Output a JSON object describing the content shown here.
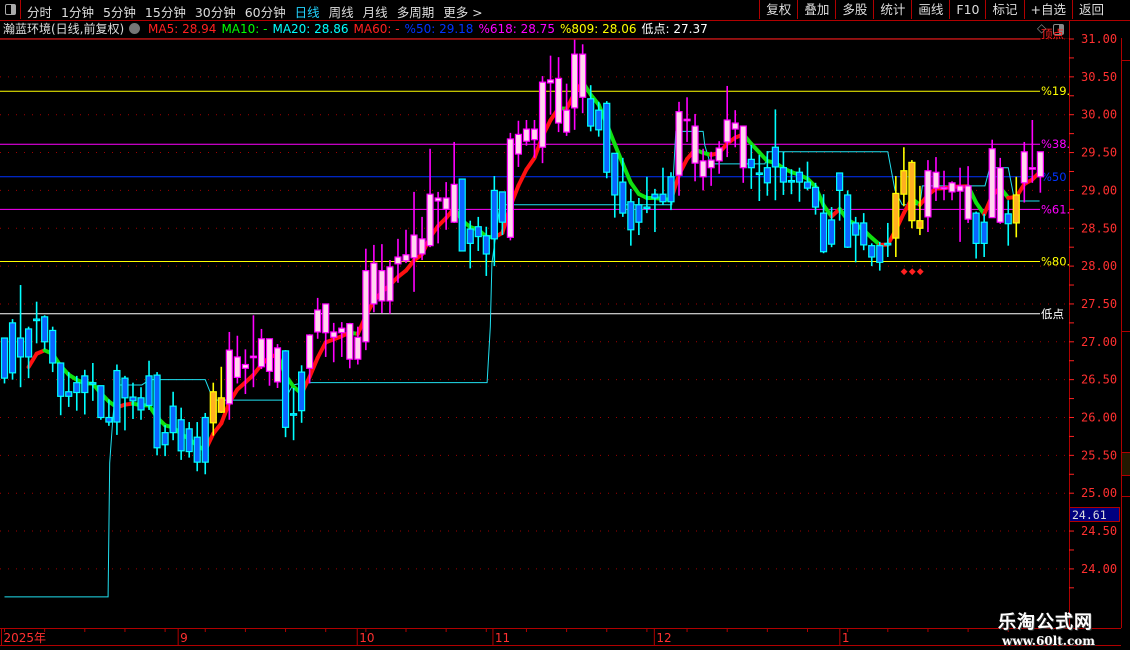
{
  "toolbar": {
    "periods": [
      "分时",
      "1分钟",
      "5分钟",
      "15分钟",
      "30分钟",
      "60分钟",
      "日线",
      "周线",
      "月线",
      "多周期",
      "更多 >"
    ],
    "active_period": "日线",
    "buttons": [
      "复权",
      "叠加",
      "多股",
      "统计",
      "画线",
      "F10",
      "标记",
      "+自选",
      "返回"
    ]
  },
  "info": {
    "title": "瀚蓝环境(日线,前复权)",
    "indicators": [
      {
        "text": "MA5: 28.94",
        "color": "#ff2020"
      },
      {
        "text": "MA10: -",
        "color": "#00ff00"
      },
      {
        "text": "MA20: 28.86",
        "color": "#00ffff"
      },
      {
        "text": "MA60: -",
        "color": "#ff2020"
      },
      {
        "text": "%50: 29.18",
        "color": "#0033ff"
      },
      {
        "text": "%618: 28.75",
        "color": "#ff00ff"
      },
      {
        "text": "%809: 28.06",
        "color": "#ffff00"
      },
      {
        "text": "低点: 27.37",
        "color": "#ffffff"
      }
    ]
  },
  "price_tag": "24.61",
  "watermark": {
    "title": "乐淘公式网",
    "url": "www.60lt.com"
  },
  "chart_data": {
    "type": "candlestick",
    "ylim": [
      23.6,
      31.0
    ],
    "y_ticks": [
      "24.00",
      "24.50",
      "25.00",
      "25.50",
      "26.00",
      "26.50",
      "27.00",
      "27.50",
      "28.00",
      "28.50",
      "29.00",
      "29.50",
      "30.00",
      "30.50",
      "31.00"
    ],
    "x_labels": [
      {
        "index": 0,
        "label": "2025年"
      },
      {
        "index": 22,
        "label": "9"
      },
      {
        "index": 44.3,
        "label": "10"
      },
      {
        "index": 61.2,
        "label": "11"
      },
      {
        "index": 81.3,
        "label": "12"
      },
      {
        "index": 104.4,
        "label": "1"
      }
    ],
    "candle_fields": [
      "open",
      "close",
      "high",
      "low",
      "style"
    ],
    "candle_styles": {
      "b": {
        "body": "#0a64ff",
        "edge": "#00ffff",
        "wick": "#00ffff"
      },
      "p": {
        "body": "#ffd6ee",
        "edge": "#ff00ff",
        "wick": "#ff00ff"
      },
      "y": {
        "body": "#ffb020",
        "edge": "#ffff00",
        "wick": "#ffff00"
      }
    },
    "candles": [
      [
        27.05,
        26.52,
        27.05,
        26.45,
        "b"
      ],
      [
        27.25,
        26.59,
        27.3,
        26.5,
        "b"
      ],
      [
        27.05,
        26.8,
        27.75,
        26.4,
        "b"
      ],
      [
        27.17,
        26.8,
        27.2,
        26.52,
        "b"
      ],
      [
        27.3,
        27.28,
        27.53,
        26.98,
        "b"
      ],
      [
        27.33,
        27.0,
        27.35,
        26.9,
        "b"
      ],
      [
        27.15,
        26.72,
        27.2,
        26.6,
        "b"
      ],
      [
        26.72,
        26.28,
        26.72,
        26.03,
        "b"
      ],
      [
        26.34,
        26.28,
        26.6,
        26.14,
        "b"
      ],
      [
        26.46,
        26.33,
        26.55,
        26.09,
        "b"
      ],
      [
        26.55,
        26.33,
        26.63,
        26.04,
        "b"
      ],
      [
        26.46,
        26.44,
        26.72,
        26.22,
        "b"
      ],
      [
        26.42,
        26.0,
        26.42,
        25.97,
        "b"
      ],
      [
        26.0,
        25.94,
        26.24,
        25.89,
        "b"
      ],
      [
        26.62,
        25.94,
        26.7,
        25.77,
        "b"
      ],
      [
        26.52,
        26.26,
        26.55,
        25.83,
        "b"
      ],
      [
        26.27,
        26.22,
        26.46,
        25.98,
        "b"
      ],
      [
        26.26,
        26.1,
        26.4,
        25.97,
        "b"
      ],
      [
        26.55,
        26.16,
        26.75,
        26.1,
        "b"
      ],
      [
        26.56,
        25.6,
        26.6,
        25.5,
        "b"
      ],
      [
        25.8,
        25.64,
        25.9,
        25.49,
        "b"
      ],
      [
        26.15,
        25.8,
        26.34,
        25.7,
        "b"
      ],
      [
        25.97,
        25.56,
        26.13,
        25.44,
        "b"
      ],
      [
        25.85,
        25.55,
        25.94,
        25.47,
        "b"
      ],
      [
        25.74,
        25.41,
        25.94,
        25.29,
        "b"
      ],
      [
        26.0,
        25.41,
        26.06,
        25.25,
        "b"
      ],
      [
        25.93,
        26.34,
        26.46,
        25.76,
        "y"
      ],
      [
        26.07,
        26.26,
        26.67,
        26.06,
        "y"
      ],
      [
        26.18,
        26.89,
        27.13,
        25.97,
        "p"
      ],
      [
        26.53,
        26.8,
        27.08,
        26.45,
        "p"
      ],
      [
        26.65,
        26.7,
        26.9,
        26.31,
        "p"
      ],
      [
        26.79,
        26.81,
        27.35,
        26.4,
        "p"
      ],
      [
        26.67,
        27.04,
        27.17,
        26.64,
        "p"
      ],
      [
        26.61,
        27.04,
        27.04,
        26.42,
        "p"
      ],
      [
        26.47,
        26.92,
        26.97,
        26.39,
        "p"
      ],
      [
        26.88,
        25.87,
        26.89,
        25.74,
        "b"
      ],
      [
        26.05,
        26.03,
        26.39,
        25.7,
        "b"
      ],
      [
        26.6,
        26.09,
        26.69,
        25.93,
        "b"
      ],
      [
        26.65,
        27.09,
        27.1,
        26.45,
        "p"
      ],
      [
        27.13,
        27.42,
        27.58,
        27.04,
        "p"
      ],
      [
        27.12,
        27.5,
        27.5,
        26.8,
        "p"
      ],
      [
        27.06,
        27.13,
        27.25,
        26.73,
        "p"
      ],
      [
        27.12,
        27.18,
        27.26,
        26.8,
        "p"
      ],
      [
        26.77,
        27.24,
        27.25,
        26.65,
        "p"
      ],
      [
        26.77,
        27.06,
        27.2,
        26.7,
        "p"
      ],
      [
        27.0,
        27.94,
        28.23,
        26.89,
        "p"
      ],
      [
        27.5,
        28.04,
        28.28,
        27.39,
        "p"
      ],
      [
        27.54,
        27.94,
        28.29,
        27.38,
        "p"
      ],
      [
        27.54,
        27.99,
        28.08,
        27.37,
        "p"
      ],
      [
        28.03,
        28.12,
        28.36,
        27.78,
        "p"
      ],
      [
        28.07,
        28.15,
        28.48,
        28.04,
        "p"
      ],
      [
        28.11,
        28.41,
        28.98,
        27.66,
        "p"
      ],
      [
        28.16,
        28.36,
        28.65,
        28.08,
        "p"
      ],
      [
        28.27,
        28.95,
        29.55,
        28.25,
        "p"
      ],
      [
        28.86,
        28.9,
        28.98,
        28.3,
        "p"
      ],
      [
        28.75,
        28.9,
        29.11,
        28.48,
        "p"
      ],
      [
        28.58,
        29.08,
        29.64,
        28.57,
        "p"
      ],
      [
        29.15,
        28.2,
        29.15,
        28.2,
        "b"
      ],
      [
        28.49,
        28.3,
        28.6,
        27.97,
        "b"
      ],
      [
        28.52,
        28.39,
        28.65,
        28.2,
        "b"
      ],
      [
        28.4,
        28.16,
        28.52,
        27.87,
        "b"
      ],
      [
        29.0,
        28.36,
        29.19,
        28.0,
        "b"
      ],
      [
        28.98,
        28.58,
        28.98,
        28.41,
        "b"
      ],
      [
        28.38,
        29.68,
        29.76,
        28.34,
        "p"
      ],
      [
        29.48,
        29.74,
        29.92,
        29.31,
        "p"
      ],
      [
        29.65,
        29.81,
        29.93,
        29.59,
        "p"
      ],
      [
        29.67,
        29.81,
        29.93,
        29.43,
        "p"
      ],
      [
        29.57,
        30.43,
        30.51,
        29.36,
        "p"
      ],
      [
        30.42,
        30.46,
        30.78,
        30.0,
        "p"
      ],
      [
        29.89,
        30.48,
        30.76,
        29.77,
        "p"
      ],
      [
        29.77,
        30.06,
        30.41,
        29.72,
        "p"
      ],
      [
        30.09,
        30.8,
        30.99,
        29.8,
        "p"
      ],
      [
        30.23,
        30.8,
        30.93,
        30.02,
        "p"
      ],
      [
        30.21,
        29.85,
        30.39,
        29.78,
        "b"
      ],
      [
        30.06,
        29.8,
        30.17,
        29.71,
        "b"
      ],
      [
        30.15,
        29.24,
        30.18,
        29.16,
        "b"
      ],
      [
        29.49,
        28.94,
        29.49,
        28.64,
        "b"
      ],
      [
        29.11,
        28.7,
        29.43,
        28.65,
        "b"
      ],
      [
        28.85,
        28.48,
        29.02,
        28.27,
        "b"
      ],
      [
        28.81,
        28.58,
        28.9,
        28.41,
        "b"
      ],
      [
        28.78,
        28.77,
        29.18,
        28.7,
        "b"
      ],
      [
        28.95,
        28.9,
        29.02,
        28.45,
        "b"
      ],
      [
        28.95,
        28.85,
        29.3,
        28.81,
        "b"
      ],
      [
        29.18,
        28.85,
        29.24,
        28.74,
        "b"
      ],
      [
        29.2,
        30.04,
        30.17,
        28.93,
        "p"
      ],
      [
        29.94,
        29.93,
        30.23,
        29.64,
        "p"
      ],
      [
        29.36,
        29.85,
        30.01,
        29.12,
        "p"
      ],
      [
        29.18,
        29.39,
        29.55,
        29.0,
        "p"
      ],
      [
        29.3,
        29.4,
        29.51,
        29.06,
        "p"
      ],
      [
        29.39,
        29.56,
        29.65,
        29.22,
        "p"
      ],
      [
        29.64,
        29.93,
        30.38,
        29.44,
        "p"
      ],
      [
        29.81,
        29.89,
        30.06,
        29.57,
        "p"
      ],
      [
        29.3,
        29.85,
        29.85,
        29.1,
        "p"
      ],
      [
        29.41,
        29.3,
        29.6,
        29.02,
        "b"
      ],
      [
        29.23,
        29.22,
        29.47,
        28.86,
        "b"
      ],
      [
        29.3,
        29.1,
        29.52,
        28.93,
        "b"
      ],
      [
        29.57,
        29.31,
        30.07,
        28.87,
        "b"
      ],
      [
        29.3,
        29.11,
        29.51,
        28.94,
        "b"
      ],
      [
        29.13,
        29.12,
        29.28,
        28.95,
        "b"
      ],
      [
        29.24,
        29.11,
        29.3,
        28.85,
        "b"
      ],
      [
        29.11,
        29.03,
        29.38,
        29.0,
        "b"
      ],
      [
        29.04,
        28.78,
        29.1,
        28.68,
        "b"
      ],
      [
        28.7,
        28.19,
        28.95,
        28.17,
        "b"
      ],
      [
        28.61,
        28.29,
        28.78,
        28.25,
        "b"
      ],
      [
        29.23,
        29.0,
        29.23,
        28.6,
        "b"
      ],
      [
        28.94,
        28.25,
        29.0,
        28.24,
        "b"
      ],
      [
        28.57,
        28.41,
        28.65,
        28.05,
        "b"
      ],
      [
        28.57,
        28.28,
        28.7,
        28.21,
        "b"
      ],
      [
        28.27,
        28.12,
        28.3,
        28.0,
        "b"
      ],
      [
        28.27,
        28.05,
        28.32,
        27.94,
        "b"
      ],
      [
        28.3,
        28.29,
        28.57,
        28.12,
        "b"
      ],
      [
        28.37,
        28.96,
        29.19,
        28.12,
        "y"
      ],
      [
        28.95,
        29.26,
        29.57,
        28.79,
        "y"
      ],
      [
        28.6,
        29.37,
        29.4,
        28.5,
        "y"
      ],
      [
        28.5,
        28.6,
        29.06,
        28.41,
        "y"
      ],
      [
        28.65,
        29.26,
        29.4,
        28.45,
        "p"
      ],
      [
        29.03,
        29.24,
        29.44,
        28.86,
        "p"
      ],
      [
        29.03,
        29.04,
        29.26,
        28.87,
        "p"
      ],
      [
        28.98,
        29.1,
        29.12,
        28.87,
        "p"
      ],
      [
        28.99,
        29.06,
        29.3,
        28.32,
        "p"
      ],
      [
        28.62,
        29.06,
        29.32,
        28.57,
        "p"
      ],
      [
        28.7,
        28.3,
        28.72,
        28.1,
        "b"
      ],
      [
        28.58,
        28.3,
        28.69,
        28.12,
        "b"
      ],
      [
        28.64,
        29.55,
        29.67,
        28.64,
        "p"
      ],
      [
        28.58,
        29.3,
        29.43,
        28.56,
        "p"
      ],
      [
        28.69,
        28.56,
        28.87,
        28.27,
        "b"
      ],
      [
        28.57,
        28.94,
        29.18,
        28.38,
        "y"
      ],
      [
        29.1,
        29.51,
        29.64,
        28.84,
        "p"
      ],
      [
        29.3,
        29.3,
        29.93,
        29.1,
        "p"
      ],
      [
        29.18,
        29.51,
        29.51,
        28.97,
        "p"
      ]
    ],
    "trend_line": {
      "type": "ema",
      "period": 6,
      "rising_color": "#ff1010",
      "falling_color": "#10e010"
    },
    "step_line": {
      "color": "#20e0f0",
      "points": [
        [
          0,
          23.63
        ],
        [
          12.9,
          23.63
        ],
        [
          13.1,
          25.4
        ],
        [
          13.5,
          26.0
        ],
        [
          13.9,
          26.43
        ],
        [
          17.1,
          26.43
        ],
        [
          18.1,
          26.5
        ],
        [
          25,
          26.5
        ],
        [
          25.6,
          26.34
        ],
        [
          26.2,
          26.23
        ],
        [
          34.9,
          26.23
        ],
        [
          35.9,
          26.43
        ],
        [
          37.4,
          26.46
        ],
        [
          60.1,
          26.46
        ],
        [
          60.5,
          27.2
        ],
        [
          60.7,
          28.04
        ],
        [
          61.7,
          28.81
        ],
        [
          83.1,
          28.81
        ],
        [
          83.6,
          29.78
        ],
        [
          87,
          29.78
        ],
        [
          87.2,
          29.6
        ],
        [
          87.9,
          29.35
        ],
        [
          94.7,
          29.35
        ],
        [
          95.1,
          29.51
        ],
        [
          110,
          29.51
        ],
        [
          110.9,
          29.0
        ],
        [
          111.8,
          28.81
        ],
        [
          114,
          28.81
        ],
        [
          114.3,
          29.06
        ],
        [
          122.1,
          29.06
        ],
        [
          122.7,
          29.3
        ],
        [
          125,
          29.3
        ],
        [
          125.8,
          28.86
        ],
        [
          128.9,
          28.86
        ]
      ]
    },
    "levels": [
      {
        "label": "顶点",
        "price": 31.0,
        "color": "#ff2020"
      },
      {
        "label": "%19.",
        "price": 30.31,
        "color": "#ffff00"
      },
      {
        "label": "%38.",
        "price": 29.61,
        "color": "#ff00ff"
      },
      {
        "label": "%50",
        "price": 29.18,
        "color": "#0033ff"
      },
      {
        "label": "%61.",
        "price": 28.75,
        "color": "#ff00ff"
      },
      {
        "label": "%80.",
        "price": 28.06,
        "color": "#ffff00"
      },
      {
        "label": "低点",
        "price": 27.37,
        "color": "#ffffff"
      }
    ],
    "signal_markers": {
      "glyph": "◆",
      "color": "#ff2020",
      "points": [
        [
          112.1,
          27.95
        ],
        [
          113.1,
          27.95
        ],
        [
          114.1,
          27.95
        ]
      ]
    }
  }
}
